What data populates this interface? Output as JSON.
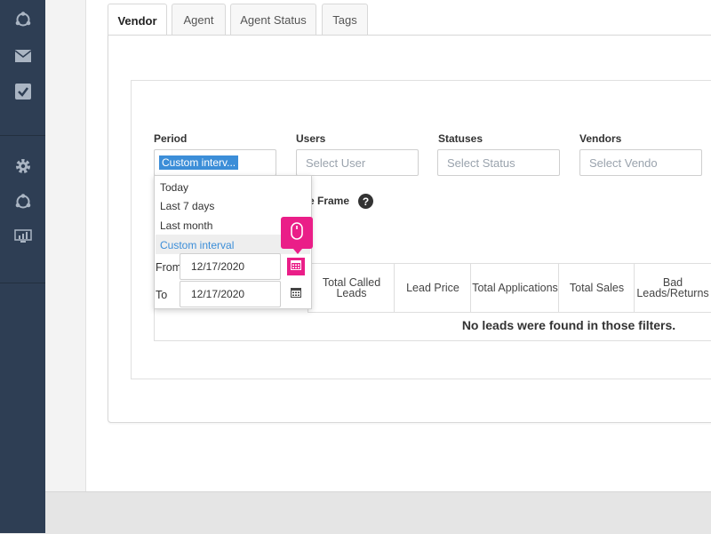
{
  "sidebar": {
    "icons": [
      "network-icon",
      "mail-icon",
      "checkbox-icon",
      "gear-icon",
      "network-icon",
      "dashboard-icon"
    ]
  },
  "tabs": [
    {
      "label": "Vendor",
      "active": true
    },
    {
      "label": "Agent"
    },
    {
      "label": "Agent Status"
    },
    {
      "label": "Tags"
    }
  ],
  "filters": {
    "period": {
      "label": "Period",
      "value": "Custom interv..."
    },
    "users": {
      "label": "Users",
      "placeholder": "Select User"
    },
    "statuses": {
      "label": "Statuses",
      "placeholder": "Select Status"
    },
    "vendors": {
      "label": "Vendors",
      "placeholder": "Select Vendo"
    }
  },
  "time_frame_label": "e Frame",
  "help_icon_glyph": "?",
  "period_dropdown": {
    "options": [
      "Today",
      "Last 7 days",
      "Last month",
      "Custom interval"
    ],
    "active_option": "Custom interval",
    "from_label": "From",
    "from_value": "12/17/2020",
    "to_label": "To",
    "to_value": "12/17/2020"
  },
  "table": {
    "columns": [
      "Total Called Leads",
      "Lead Price",
      "Total Applications",
      "Total Sales",
      "Bad Leads/Returns"
    ],
    "empty_message": "No leads were found in those filters."
  },
  "colors": {
    "sidebar": "#2e3e54",
    "accent": "#3c8ed8",
    "highlight": "#ea1e88"
  }
}
